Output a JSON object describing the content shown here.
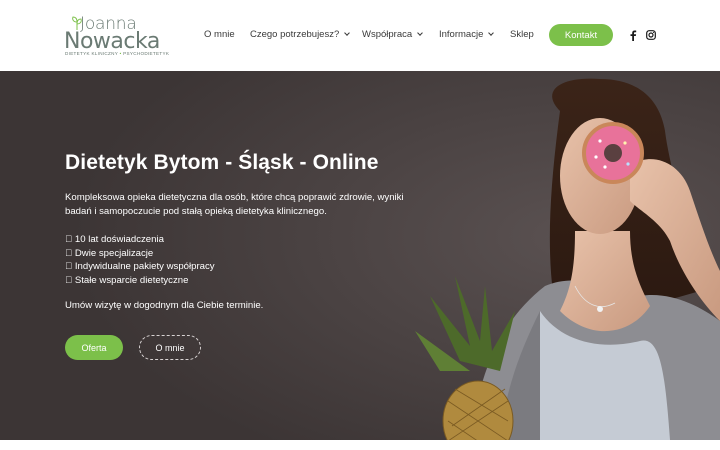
{
  "logo": {
    "first_name": "Joanna",
    "last_name": "Nowacka",
    "subtitle_left": "DIETETYK KLINICZNY",
    "subtitle_sep": "•",
    "subtitle_right": "PSYCHODIETETYK"
  },
  "nav": {
    "items": [
      {
        "label": "O mnie"
      },
      {
        "label": "Czego potrzebujesz?"
      },
      {
        "label": "Współpraca"
      },
      {
        "label": "Informacje"
      },
      {
        "label": "Sklep"
      }
    ],
    "contact_label": "Kontakt",
    "social": [
      "facebook-icon",
      "instagram-icon"
    ]
  },
  "hero": {
    "title": "Dietetyk Bytom - Śląsk - Online",
    "description": "Kompleksowa opieka dietetyczna dla osób, które chcą poprawić zdrowie, wyniki badań i samopoczucie pod stałą opieką dietetyka klinicznego.",
    "features": [
      "󰄬 10 lat doświadczenia",
      "󰄬 Dwie specjalizacje",
      "󰄬 Indywidualne pakiety współpracy",
      "󰄬 Stałe wsparcie dietetyczne"
    ],
    "cta_text": "Umów wizytę w dogodnym dla Ciebie terminie.",
    "offer_button": "Oferta",
    "about_button": "O mnie"
  },
  "colors": {
    "accent": "#7cc04a",
    "hero_bg": "#3f3838",
    "logo": "#6a7a73"
  }
}
